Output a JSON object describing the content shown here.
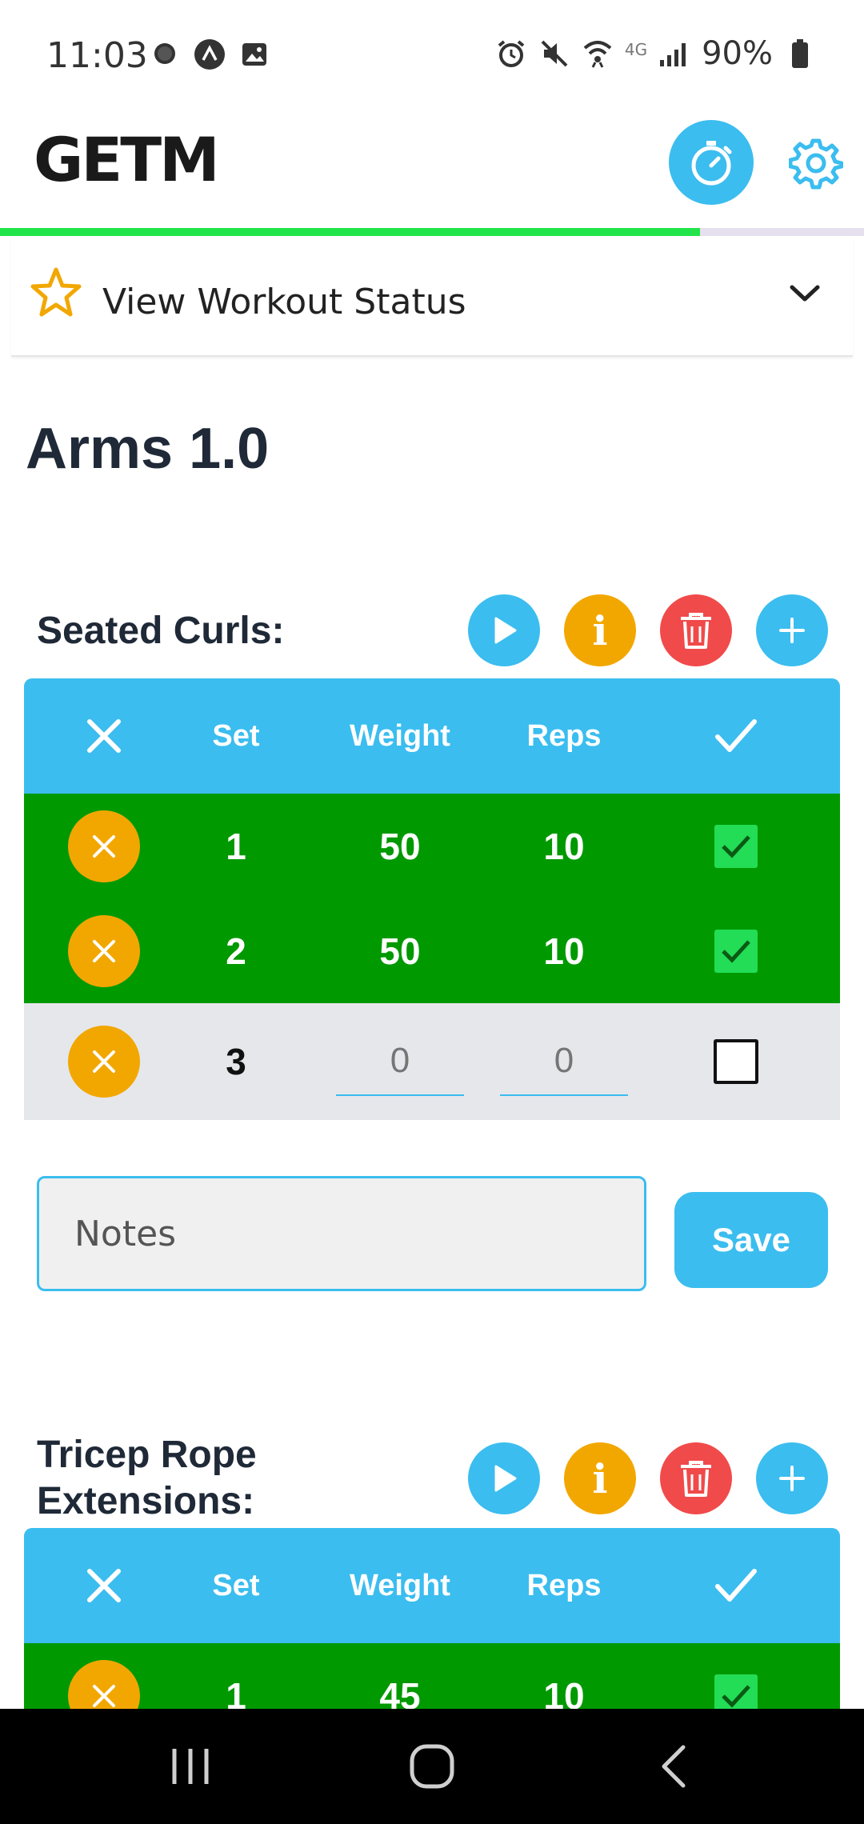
{
  "status_bar": {
    "time": "11:03",
    "network": "4G",
    "battery": "90%",
    "left_icons": [
      "chat-bubble-icon",
      "app-a-icon",
      "gallery-icon"
    ],
    "right_icons": [
      "alarm-icon",
      "mute-icon",
      "wifi-icon",
      "signal-icon",
      "battery-icon"
    ]
  },
  "app": {
    "logo": "GETM",
    "timer_icon": "stopwatch-icon",
    "settings_icon": "gear-icon",
    "progress_fraction": 0.81,
    "colors": {
      "accent": "#3bbdef",
      "progress": "#22e44a",
      "done_row": "#009900",
      "warning": "#f2a700",
      "danger": "#f14a4a"
    }
  },
  "status_card": {
    "label": "View Workout Status"
  },
  "workout": {
    "title": "Arms 1.0"
  },
  "exercises": [
    {
      "name": "Seated Curls:",
      "headers": {
        "set": "Set",
        "weight": "Weight",
        "reps": "Reps"
      },
      "rows": [
        {
          "set": "1",
          "weight": "50",
          "reps": "10",
          "done": true
        },
        {
          "set": "2",
          "weight": "50",
          "reps": "10",
          "done": true
        },
        {
          "set": "3",
          "weight": "0",
          "reps": "0",
          "done": false
        }
      ]
    },
    {
      "name": "Tricep Rope Extensions:",
      "headers": {
        "set": "Set",
        "weight": "Weight",
        "reps": "Reps"
      },
      "rows": [
        {
          "set": "1",
          "weight": "45",
          "reps": "10",
          "done": true
        }
      ]
    }
  ],
  "notes": {
    "placeholder": "Notes",
    "save_label": "Save"
  }
}
